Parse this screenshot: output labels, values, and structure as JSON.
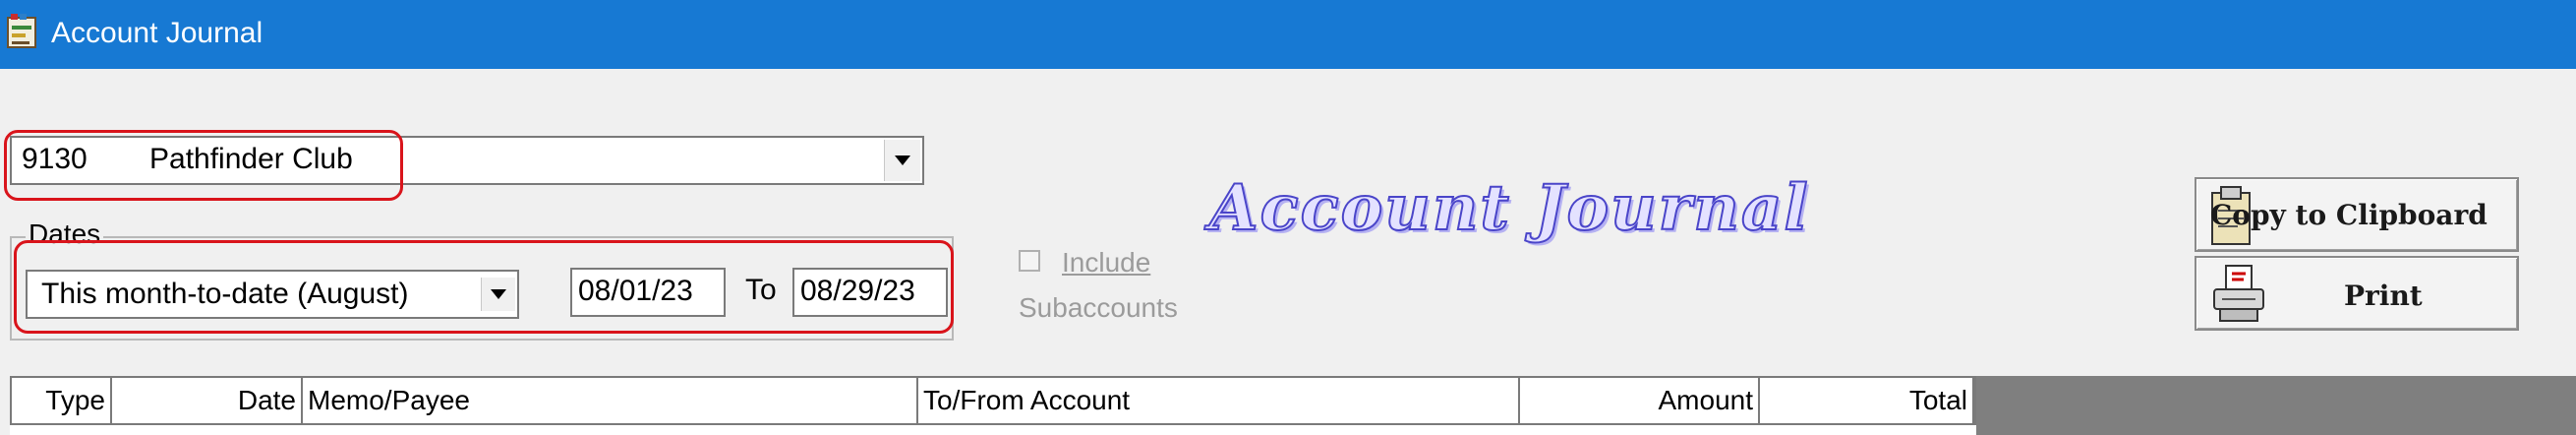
{
  "window": {
    "title": "Account Journal",
    "icon": "account-journal-app-icon",
    "titlebar_color": "#1779d3"
  },
  "account": {
    "number": "9130",
    "name": "Pathfinder Club"
  },
  "dates": {
    "group_label": "Dates",
    "range_selected": "This month-to-date (August)",
    "from": "08/01/23",
    "to_label": "To",
    "to": "08/29/23"
  },
  "include_subaccounts": {
    "checked": false,
    "line1": "Include",
    "line2": "Subaccounts"
  },
  "banner": {
    "text": "Account Journal"
  },
  "buttons": {
    "copy": "Copy to Clipboard",
    "print": "Print"
  },
  "grid": {
    "columns": [
      "Type",
      "Date",
      "Memo/Payee",
      "To/From Account",
      "Amount",
      "Total"
    ]
  },
  "highlight_color": "#d9141b"
}
